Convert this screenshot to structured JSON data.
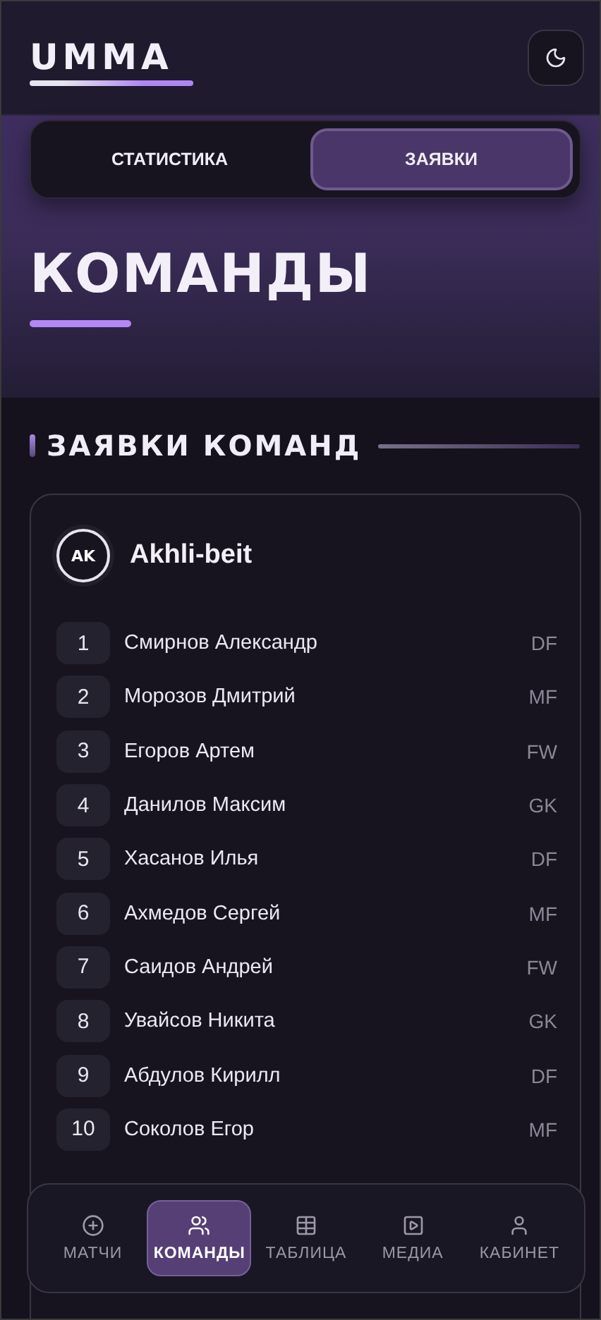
{
  "logo": "UMMA",
  "tabs": [
    {
      "label": "СТАТИСТИКА",
      "selected": false
    },
    {
      "label": "ЗАЯВКИ",
      "selected": true
    }
  ],
  "title": "КОМАНДЫ",
  "section_title": "ЗАЯВКИ КОМАНД",
  "team": {
    "initials": "AK",
    "name": "Akhli-beit",
    "players": [
      {
        "number": "1",
        "name": "Смирнов Александр",
        "position": "DF"
      },
      {
        "number": "2",
        "name": "Морозов Дмитрий",
        "position": "MF"
      },
      {
        "number": "3",
        "name": "Егоров Артем",
        "position": "FW"
      },
      {
        "number": "4",
        "name": "Данилов Максим",
        "position": "GK"
      },
      {
        "number": "5",
        "name": "Хасанов Илья",
        "position": "DF"
      },
      {
        "number": "6",
        "name": "Ахмедов Сергей",
        "position": "MF"
      },
      {
        "number": "7",
        "name": "Саидов Андрей",
        "position": "FW"
      },
      {
        "number": "8",
        "name": "Увайсов Никита",
        "position": "GK"
      },
      {
        "number": "9",
        "name": "Абдулов Кирилл",
        "position": "DF"
      },
      {
        "number": "10",
        "name": "Соколов Егор",
        "position": "MF"
      }
    ]
  },
  "nav": [
    {
      "kind": "plus",
      "label": "МАТЧИ",
      "selected": false
    },
    {
      "kind": "users",
      "label": "КОМАНДЫ",
      "selected": true
    },
    {
      "kind": "table",
      "label": "ТАБЛИЦА",
      "selected": false
    },
    {
      "kind": "play",
      "label": "МЕДИА",
      "selected": false
    },
    {
      "kind": "user",
      "label": "КАБИНЕТ",
      "selected": false
    }
  ]
}
